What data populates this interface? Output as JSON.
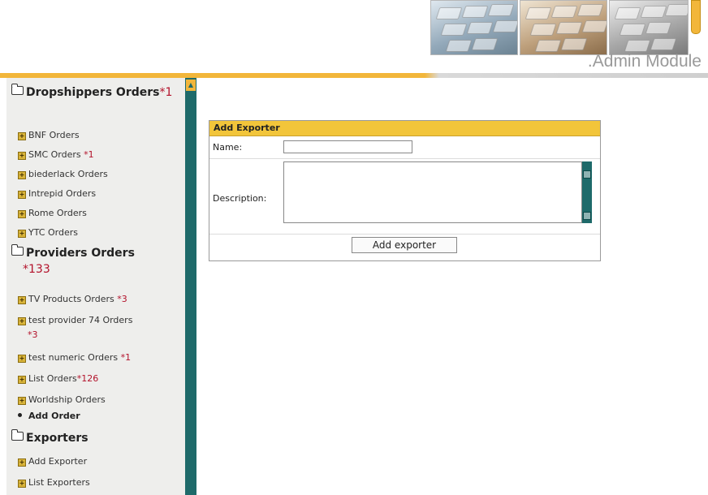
{
  "header": {
    "title": ".Admin Module"
  },
  "sidebar": {
    "sections": [
      {
        "title": "Dropshippers Orders",
        "count": "*1",
        "items": [
          {
            "label": "BNF Orders",
            "count": ""
          },
          {
            "label": "SMC Orders",
            "count": "*1"
          },
          {
            "label": "biederlack Orders",
            "count": ""
          },
          {
            "label": "Intrepid Orders",
            "count": ""
          },
          {
            "label": "Rome Orders",
            "count": ""
          },
          {
            "label": "YTC Orders",
            "count": ""
          }
        ]
      },
      {
        "title": "Providers Orders",
        "count": "*133",
        "items": [
          {
            "label": "TV Products Orders",
            "count": "*3"
          },
          {
            "label": "test provider 74 Orders",
            "count": "*3"
          },
          {
            "label": "test numeric Orders",
            "count": "*1"
          },
          {
            "label": "List Orders",
            "count": "*126"
          },
          {
            "label": "Worldship Orders",
            "count": ""
          }
        ],
        "bullet_item": "Add Order"
      },
      {
        "title": "Exporters",
        "count": "",
        "items": [
          {
            "label": "Add Exporter",
            "count": ""
          },
          {
            "label": "List Exporters",
            "count": ""
          }
        ]
      }
    ]
  },
  "form": {
    "title": "Add Exporter",
    "name_label": "Name:",
    "name_value": "",
    "description_label": "Description:",
    "description_value": "",
    "submit_label": "Add exporter"
  },
  "colors": {
    "accent": "#f2b63a",
    "sidebar_scroll": "#1e6a6a",
    "count": "#b3122b"
  }
}
